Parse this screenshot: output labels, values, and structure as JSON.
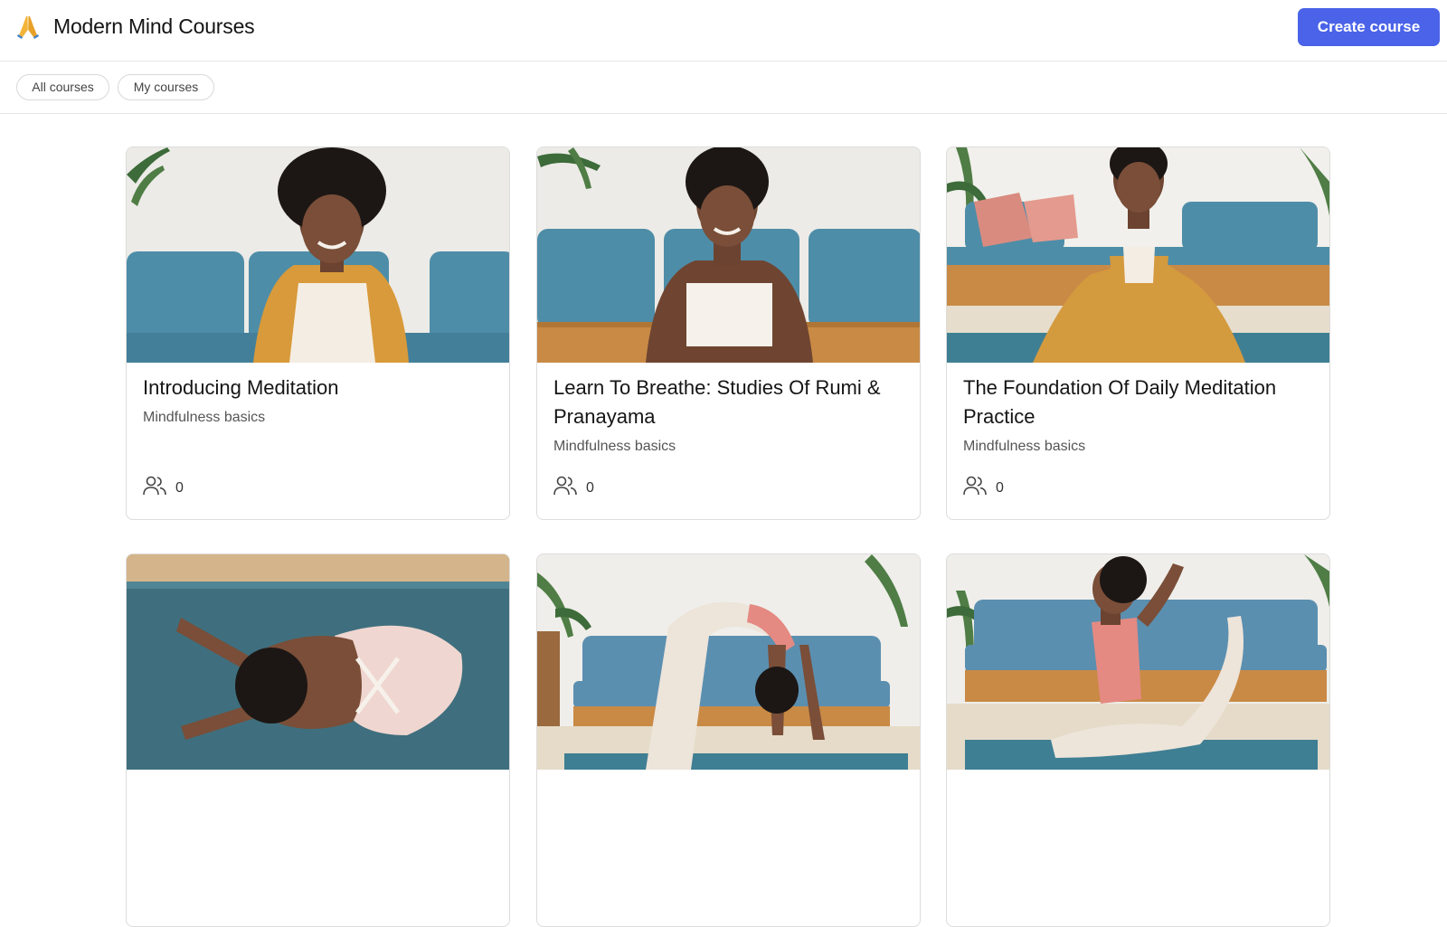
{
  "header": {
    "logo_icon": "folded-hands-icon",
    "title": "Modern Mind Courses",
    "create_label": "Create course"
  },
  "filters": {
    "all_label": "All courses",
    "mine_label": "My courses"
  },
  "colors": {
    "accent": "#4a63e8",
    "sofa": "#4e8da8",
    "mat": "#3f7f93"
  },
  "courses": [
    {
      "title": "Introducing Meditation",
      "subtitle": "Mindfulness basics",
      "members": "0",
      "members_icon": "people-icon"
    },
    {
      "title": "Learn To Breathe: Studies Of Rumi & Pranayama",
      "subtitle": "Mindfulness basics",
      "members": "0",
      "members_icon": "people-icon"
    },
    {
      "title": "The Foundation Of Daily Meditation Practice",
      "subtitle": "Mindfulness basics",
      "members": "0",
      "members_icon": "people-icon"
    },
    {
      "title": "",
      "subtitle": "",
      "members": ""
    },
    {
      "title": "",
      "subtitle": "",
      "members": ""
    },
    {
      "title": "",
      "subtitle": "",
      "members": ""
    }
  ]
}
